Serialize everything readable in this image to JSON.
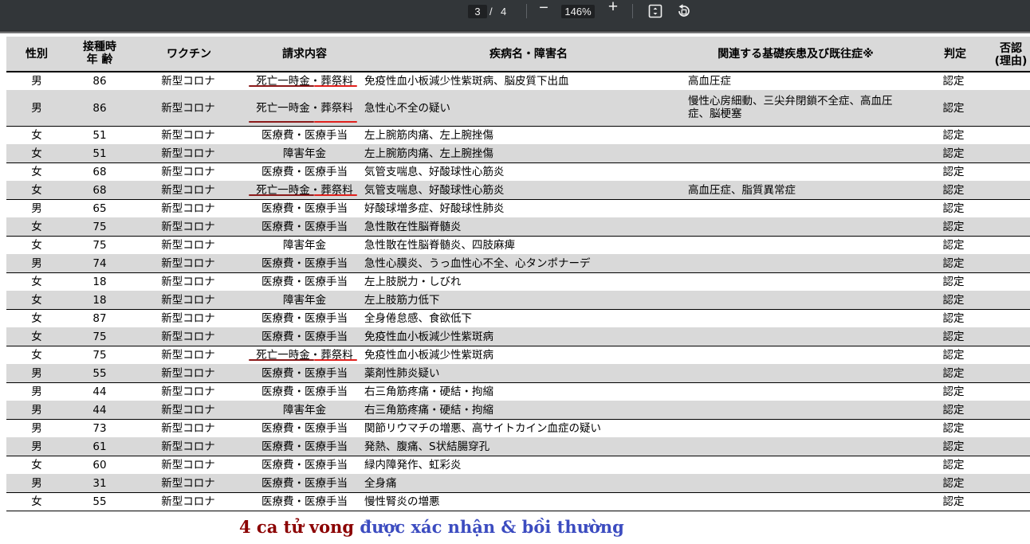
{
  "toolbar": {
    "page_current": "3",
    "page_separator": "/",
    "page_total": "4",
    "zoom_out": "−",
    "zoom_level": "146%",
    "zoom_in": "+",
    "icons": [
      "zoom-out-icon",
      "zoom-in-icon",
      "fit-page-icon",
      "rotate-icon"
    ]
  },
  "table": {
    "headers": {
      "sex": "性別",
      "age_line1": "接種時",
      "age_line2": "年 齢",
      "vaccine": "ワクチン",
      "claim": "請求内容",
      "disease": "疾病名・障害名",
      "underlying": "関連する基礎疾患及び既往症※",
      "judgment": "判定",
      "denial_line1": "否認",
      "denial_line2": "(理由)"
    },
    "rows": [
      {
        "sex": "男",
        "age": "86",
        "vaccine": "新型コロナ",
        "claim": "死亡一時金・葬祭料",
        "disease": "免疫性血小板減少性紫斑病、脳皮質下出血",
        "underlying": "高血圧症",
        "underlying2": "",
        "judgment": "認定",
        "shaded": false,
        "marked": true
      },
      {
        "sex": "男",
        "age": "86",
        "vaccine": "新型コロナ",
        "claim": "死亡一時金・葬祭料",
        "disease": "急性心不全の疑い",
        "underlying": "慢性心房細動、三尖弁閉鎖不全症、高血圧",
        "underlying2": "症、脳梗塞",
        "judgment": "認定",
        "shaded": true,
        "marked": true
      },
      {
        "sex": "女",
        "age": "51",
        "vaccine": "新型コロナ",
        "claim": "医療費・医療手当",
        "disease": "左上腕筋肉痛、左上腕挫傷",
        "underlying": "",
        "underlying2": "",
        "judgment": "認定",
        "shaded": false,
        "marked": false
      },
      {
        "sex": "女",
        "age": "51",
        "vaccine": "新型コロナ",
        "claim": "障害年金",
        "disease": "左上腕筋肉痛、左上腕挫傷",
        "underlying": "",
        "underlying2": "",
        "judgment": "認定",
        "shaded": true,
        "marked": false
      },
      {
        "sex": "女",
        "age": "68",
        "vaccine": "新型コロナ",
        "claim": "医療費・医療手当",
        "disease": "気管支喘息、好酸球性心筋炎",
        "underlying": "",
        "underlying2": "",
        "judgment": "認定",
        "shaded": false,
        "marked": false
      },
      {
        "sex": "女",
        "age": "68",
        "vaccine": "新型コロナ",
        "claim": "死亡一時金・葬祭料",
        "disease": "気管支喘息、好酸球性心筋炎",
        "underlying": "高血圧症、脂質異常症",
        "underlying2": "",
        "judgment": "認定",
        "shaded": true,
        "marked": true
      },
      {
        "sex": "男",
        "age": "65",
        "vaccine": "新型コロナ",
        "claim": "医療費・医療手当",
        "disease": "好酸球増多症、好酸球性肺炎",
        "underlying": "",
        "underlying2": "",
        "judgment": "認定",
        "shaded": false,
        "marked": false
      },
      {
        "sex": "女",
        "age": "75",
        "vaccine": "新型コロナ",
        "claim": "医療費・医療手当",
        "disease": "急性散在性脳脊髄炎",
        "underlying": "",
        "underlying2": "",
        "judgment": "認定",
        "shaded": true,
        "marked": false
      },
      {
        "sex": "女",
        "age": "75",
        "vaccine": "新型コロナ",
        "claim": "障害年金",
        "disease": "急性散在性脳脊髄炎、四肢麻痺",
        "underlying": "",
        "underlying2": "",
        "judgment": "認定",
        "shaded": false,
        "marked": false
      },
      {
        "sex": "男",
        "age": "74",
        "vaccine": "新型コロナ",
        "claim": "医療費・医療手当",
        "disease": "急性心膜炎、うっ血性心不全、心タンポナーデ",
        "underlying": "",
        "underlying2": "",
        "judgment": "認定",
        "shaded": true,
        "marked": false
      },
      {
        "sex": "女",
        "age": "18",
        "vaccine": "新型コロナ",
        "claim": "医療費・医療手当",
        "disease": "左上肢脱力・しびれ",
        "underlying": "",
        "underlying2": "",
        "judgment": "認定",
        "shaded": false,
        "marked": false
      },
      {
        "sex": "女",
        "age": "18",
        "vaccine": "新型コロナ",
        "claim": "障害年金",
        "disease": "左上肢筋力低下",
        "underlying": "",
        "underlying2": "",
        "judgment": "認定",
        "shaded": true,
        "marked": false
      },
      {
        "sex": "女",
        "age": "87",
        "vaccine": "新型コロナ",
        "claim": "医療費・医療手当",
        "disease": "全身倦怠感、食欲低下",
        "underlying": "",
        "underlying2": "",
        "judgment": "認定",
        "shaded": false,
        "marked": false
      },
      {
        "sex": "女",
        "age": "75",
        "vaccine": "新型コロナ",
        "claim": "医療費・医療手当",
        "disease": "免疫性血小板減少性紫斑病",
        "underlying": "",
        "underlying2": "",
        "judgment": "認定",
        "shaded": true,
        "marked": false
      },
      {
        "sex": "女",
        "age": "75",
        "vaccine": "新型コロナ",
        "claim": "死亡一時金・葬祭料",
        "disease": "免疫性血小板減少性紫斑病",
        "underlying": "",
        "underlying2": "",
        "judgment": "認定",
        "shaded": false,
        "marked": true
      },
      {
        "sex": "男",
        "age": "55",
        "vaccine": "新型コロナ",
        "claim": "医療費・医療手当",
        "disease": "薬剤性肺炎疑い",
        "underlying": "",
        "underlying2": "",
        "judgment": "認定",
        "shaded": true,
        "marked": false
      },
      {
        "sex": "男",
        "age": "44",
        "vaccine": "新型コロナ",
        "claim": "医療費・医療手当",
        "disease": "右三角筋疼痛・硬結・拘縮",
        "underlying": "",
        "underlying2": "",
        "judgment": "認定",
        "shaded": false,
        "marked": false
      },
      {
        "sex": "男",
        "age": "44",
        "vaccine": "新型コロナ",
        "claim": "障害年金",
        "disease": "右三角筋疼痛・硬結・拘縮",
        "underlying": "",
        "underlying2": "",
        "judgment": "認定",
        "shaded": true,
        "marked": false
      },
      {
        "sex": "男",
        "age": "73",
        "vaccine": "新型コロナ",
        "claim": "医療費・医療手当",
        "disease": "関節リウマチの増悪、高サイトカイン血症の疑い",
        "underlying": "",
        "underlying2": "",
        "judgment": "認定",
        "shaded": false,
        "marked": false
      },
      {
        "sex": "男",
        "age": "61",
        "vaccine": "新型コロナ",
        "claim": "医療費・医療手当",
        "disease": "発熱、腹痛、S状結腸穿孔",
        "underlying": "",
        "underlying2": "",
        "judgment": "認定",
        "shaded": true,
        "marked": false
      },
      {
        "sex": "女",
        "age": "60",
        "vaccine": "新型コロナ",
        "claim": "医療費・医療手当",
        "disease": "緑内障発作、虹彩炎",
        "underlying": "",
        "underlying2": "",
        "judgment": "認定",
        "shaded": false,
        "marked": false
      },
      {
        "sex": "男",
        "age": "31",
        "vaccine": "新型コロナ",
        "claim": "医療費・医療手当",
        "disease": "全身痛",
        "underlying": "",
        "underlying2": "",
        "judgment": "認定",
        "shaded": true,
        "marked": false
      },
      {
        "sex": "女",
        "age": "55",
        "vaccine": "新型コロナ",
        "claim": "医療費・医療手当",
        "disease": "慢性腎炎の増悪",
        "underlying": "",
        "underlying2": "",
        "judgment": "認定",
        "shaded": false,
        "marked": false
      }
    ]
  },
  "annotation": {
    "caption_part1": "4 ca tử vong ",
    "caption_part2": "được xác nhận & bồi thường",
    "underline_colors": [
      "#8b1a1a",
      "#e0201c"
    ],
    "caption_colors": [
      "#8b0000",
      "#3c4cc0"
    ]
  }
}
